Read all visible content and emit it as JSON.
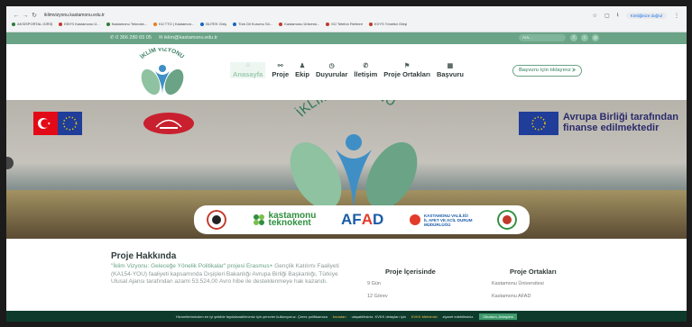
{
  "browser": {
    "url": "iklimvizyonu.kastamonu.edu.tr",
    "profile": "Kimliğinize doğrul",
    "bookmarks": [
      {
        "label": "AKSİSPORTAL GİRİŞ",
        "color": "#2a7a3c"
      },
      {
        "label": "EBYS Kastamonu Ü...",
        "color": "#c0392b"
      },
      {
        "label": "Kastamonu Teknoke...",
        "color": "#2e7d32"
      },
      {
        "label": "KÜ TTO | Kastamon...",
        "color": "#e67e22"
      },
      {
        "label": "BUTEK Giriş",
        "color": "#1565c0"
      },
      {
        "label": "Türk Dil Kurumu Sö...",
        "color": "#1565c0"
      },
      {
        "label": "Kastamonu Üniversi...",
        "color": "#c0392b"
      },
      {
        "label": "KÜ Telefon Rehberi",
        "color": "#c0392b"
      },
      {
        "label": "KVYS Yönetici Girişi",
        "color": "#c0392b"
      }
    ]
  },
  "topbar": {
    "phone": "0 366 280 65 05",
    "email": "iklim@kastamonu.edu.tr",
    "search_placeholder": "Ara...",
    "social": [
      "f",
      "t",
      "ig"
    ]
  },
  "nav": {
    "logo_text": "İKLİM VİZYONU",
    "items": [
      {
        "label": "Anasayfa",
        "icon": "home-icon",
        "glyph": "⌂",
        "active": true
      },
      {
        "label": "Proje",
        "icon": "sitemap-icon",
        "glyph": "⚯",
        "active": false
      },
      {
        "label": "Ekip",
        "icon": "team-icon",
        "glyph": "♟",
        "active": false
      },
      {
        "label": "Duyurular",
        "icon": "clock-icon",
        "glyph": "◷",
        "active": false
      },
      {
        "label": "İletişim",
        "icon": "phone-icon",
        "glyph": "✆",
        "active": false
      },
      {
        "label": "Proje Ortakları",
        "icon": "bookmark-icon",
        "glyph": "⚑",
        "active": false
      },
      {
        "label": "Başvuru",
        "icon": "calendar-icon",
        "glyph": "▦",
        "active": false
      }
    ],
    "apply_button": "Başvuru için tıklayınız ⮞"
  },
  "hero": {
    "title": "İKLİM VİZYONU",
    "eu_text_line1": "Avrupa Birliği tarafından",
    "eu_text_line2": "finanse edilmektedir",
    "partners": {
      "teknokent_line1": "kastamonu",
      "teknokent_line2": "teknokent",
      "afad": "AFAD",
      "valilik_line1": "KASTAMONU VALİLİĞİ",
      "valilik_line2": "İL AFET VE ACİL DURUM",
      "valilik_line3": "MÜDÜRLÜĞÜ"
    }
  },
  "content": {
    "title": "Proje Hakkında",
    "text_highlight": "\"İklim Vizyonu: Geleceğe Yönelik Politikalar\" projesi Erasmus+",
    "text_rest": "Gençlik Katılımı Faaliyeti (KA154-YOU) faaliyeti kapsamında Dışişleri Bakanlığı Avrupa Birliği Başkanlığı, Türkiye Ulusal Ajansı tarafından azami 53.524,00 Avro hibe ile desteklenmeye hak kazandı.",
    "stats": {
      "title": "Proje İçerisinde",
      "items": [
        "9 Gün",
        "12 Görev"
      ]
    },
    "partners": {
      "title": "Proje Ortakları",
      "items": [
        "Kastamonu Üniversitesi",
        "Kastamonu AFAD"
      ]
    }
  },
  "cookie": {
    "text_before": "Hizmetlerimizden en iyi şekilde faydalanabilmeniz için çerezler kullanıyoruz. Çerez politikamıza",
    "link1": "buradan",
    "text_middle": "ulaşabilirsiniz. KVKK detayları için",
    "link2": "KVKK Metnimizi",
    "text_after": "ziyaret edebilirsiniz.",
    "button": "Okudum, Anlaşılmı"
  }
}
